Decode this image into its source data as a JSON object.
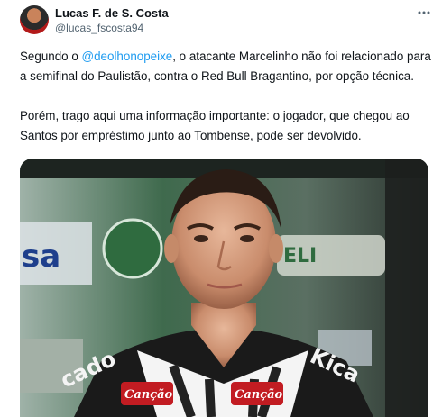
{
  "author": {
    "name": "Lucas F. de S. Costa",
    "handle": "@lucas_fscosta94"
  },
  "tweet": {
    "p1_start": "Segundo o ",
    "mention": "@deolhonopeixe",
    "p1_end": ", o atacante Marcelinho não foi relacionado para a semifinal do Paulistão, contra o Red Bull Bragantino, por opção técnica.",
    "p2": "Porém, trago aqui uma informação importante: o jogador, que chegou ao Santos por empréstimo junto ao Tombense, pode ser devolvido."
  },
  "media": {
    "shirt_sponsor_left": "Canção",
    "shirt_sponsor_right": "Canção",
    "shirt_text_left": "cado",
    "shirt_text_right": "Kica"
  },
  "icons": [
    "more-icon"
  ],
  "colors": {
    "link": "#1d9bf0",
    "secondary_text": "#536471"
  }
}
